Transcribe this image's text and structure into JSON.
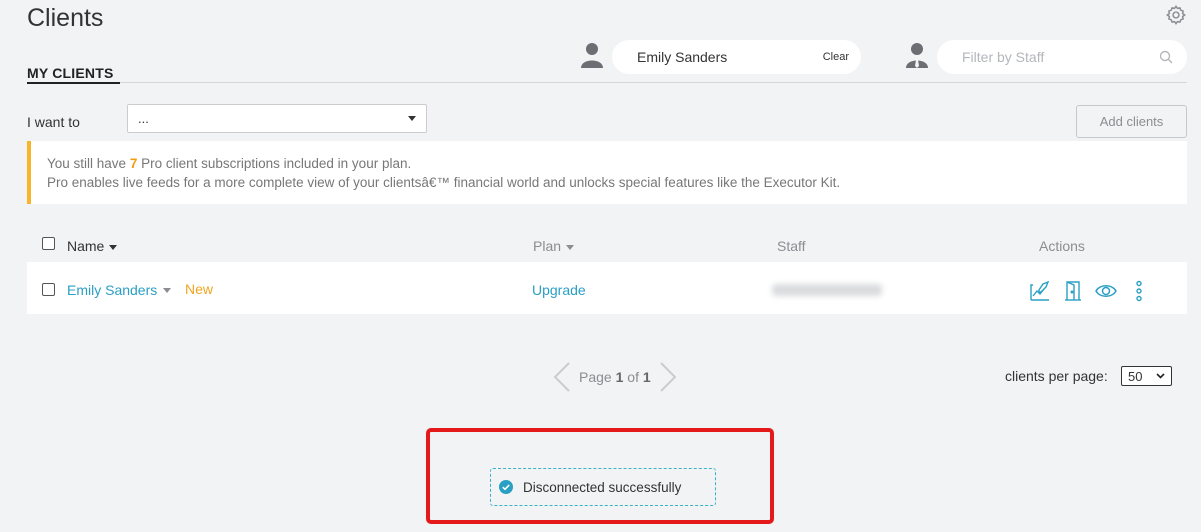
{
  "page": {
    "title": "Clients",
    "tab": "MY CLIENTS"
  },
  "client_filter": {
    "value": "Emily Sanders",
    "clear_label": "Clear"
  },
  "staff_filter": {
    "placeholder": "Filter by Staff"
  },
  "action_bar": {
    "label": "I want to",
    "selected": "...",
    "add_button": "Add clients"
  },
  "notice": {
    "line1_prefix": "You still have ",
    "count": "7",
    "line1_suffix": " Pro client subscriptions included in your plan.",
    "line2": "Pro enables live feeds for a more complete view of your clientsâ€™ financial world and unlocks special features like the Executor Kit."
  },
  "table": {
    "headers": {
      "name": "Name",
      "plan": "Plan",
      "staff": "Staff",
      "actions": "Actions"
    },
    "rows": [
      {
        "name": "Emily Sanders",
        "badge": "New",
        "plan": "Upgrade"
      }
    ]
  },
  "pagination": {
    "prefix": "Page ",
    "current": "1",
    "of": " of ",
    "total": "1",
    "per_page_label": "clients per page:",
    "per_page_value": "50"
  },
  "toast": {
    "message": "Disconnected successfully"
  },
  "colors": {
    "accent": "#2a9fc4",
    "warning": "#f7b52c",
    "highlight": "#e3191b",
    "background": "#f2f3f5"
  }
}
